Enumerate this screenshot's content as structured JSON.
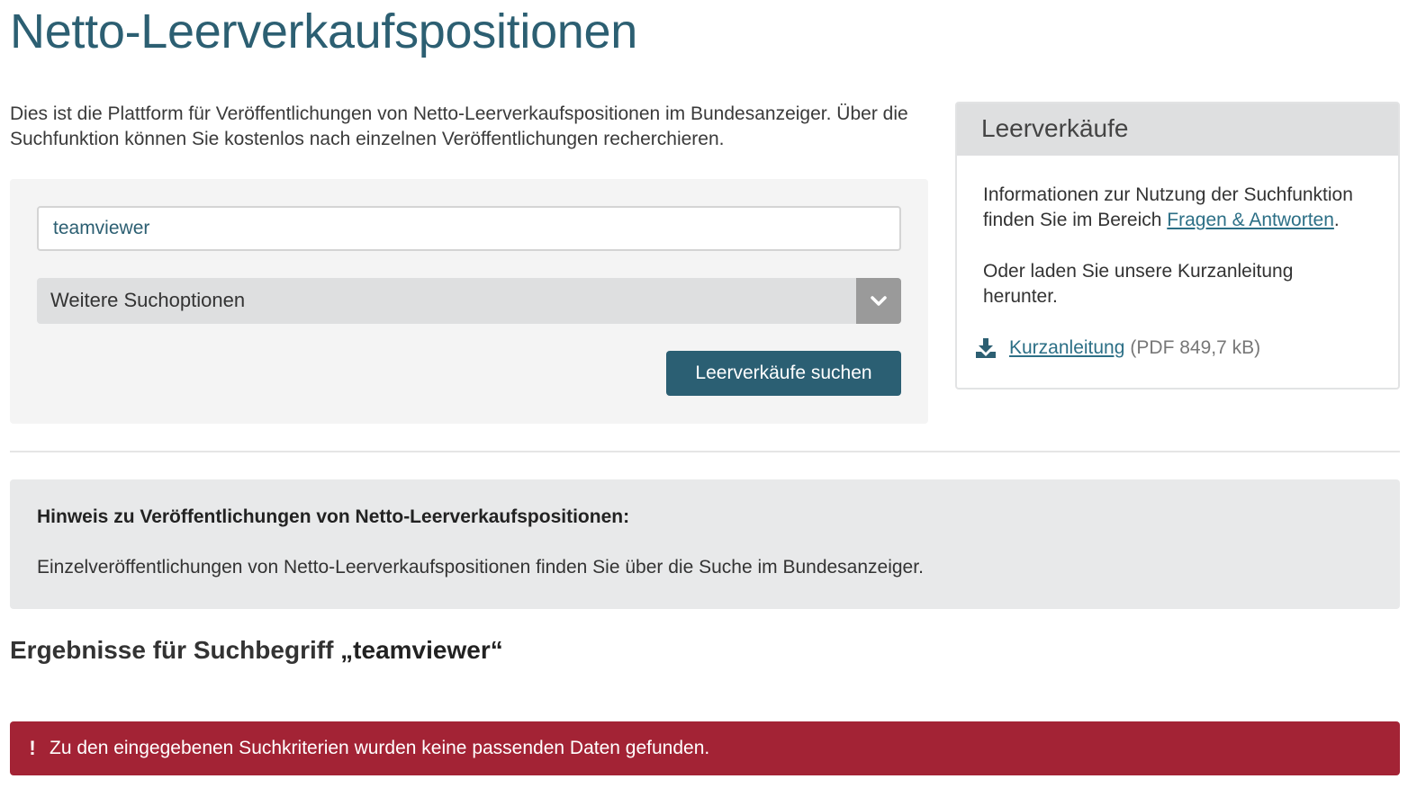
{
  "page": {
    "title": "Netto-Leerverkaufspositionen",
    "intro": "Dies ist die Plattform für Veröffentlichungen von Netto-Leerverkaufspositionen im Bundesanzeiger. Über die Suchfunktion können Sie kostenlos nach einzelnen Veröffentlichungen recherchieren."
  },
  "search": {
    "value": "teamviewer",
    "options_label": "Weitere Suchoptionen",
    "button_label": "Leerverkäufe suchen"
  },
  "sidebar": {
    "title": "Leerverkäufe",
    "info_text_before": "Informationen zur Nutzung der Suchfunktion finden Sie im Bereich ",
    "faq_link": "Fragen & Antworten",
    "info_text_after": ".",
    "guide_text": "Oder laden Sie unsere Kurzanleitung herunter.",
    "download_label": "Kurzanleitung",
    "download_meta": "(PDF 849,7 kB)"
  },
  "notice": {
    "title": "Hinweis zu Veröffentlichungen von Netto-Leerverkaufspositionen:",
    "text": "Einzelveröffentlichungen von Netto-Leerverkaufspositionen finden Sie über die Suche im Bundesanzeiger."
  },
  "results": {
    "prefix": "Ergebnisse für Suchbegriff ",
    "term": "„teamviewer“"
  },
  "alert": {
    "icon": "!",
    "message": "Zu den eingegebenen Suchkriterien wurden keine passenden Daten gefunden."
  },
  "colors": {
    "primary": "#2b5f73",
    "error": "#a32335",
    "panel": "#f4f4f4"
  },
  "icons": {
    "options": "chevron-down-icon",
    "download": "download-icon",
    "alert": "exclamation-icon"
  }
}
